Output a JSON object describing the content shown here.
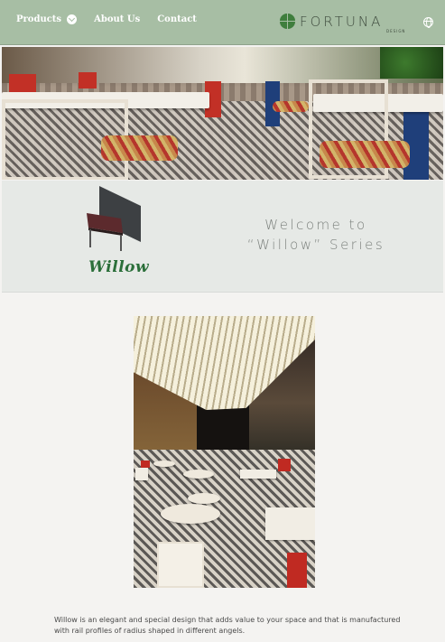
{
  "header": {
    "nav": [
      {
        "label": "Products",
        "has_dropdown": true
      },
      {
        "label": "About Us",
        "has_dropdown": false
      },
      {
        "label": "Contact",
        "has_dropdown": false
      }
    ],
    "logo_text": "FORTUNA",
    "logo_sub": "DESIGN",
    "language_icon": "globe-icon"
  },
  "hero": {
    "alt_icon": "restaurant-photo"
  },
  "welcome": {
    "line1": "Welcome to",
    "line2": "“Willow” Series",
    "product_logo": "Willow"
  },
  "main": {
    "description": "Willow is an elegant and special design that adds value to your space and that is manufactured with rail profiles of radius shaped in different angels."
  },
  "colors": {
    "header_bg": "#a7bea4",
    "band_bg": "#e6e9e6",
    "accent_green": "#2b6f3a"
  }
}
